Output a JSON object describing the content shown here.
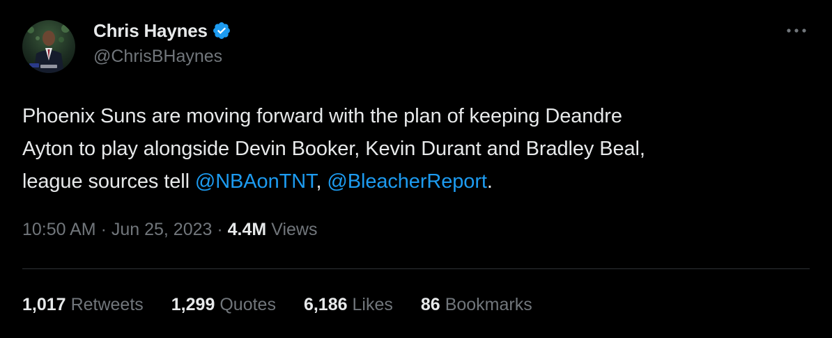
{
  "author": {
    "display_name": "Chris Haynes",
    "handle": "@ChrisBHaynes",
    "verified_icon": "verified-badge-icon"
  },
  "more_icon": "more-options-icon",
  "tweet": {
    "line1": "Phoenix Suns are moving forward with the plan of keeping Deandre",
    "line2": "Ayton to play alongside Devin Booker, Kevin Durant and Bradley Beal,",
    "line3_prefix": "league sources tell ",
    "mention1": "@NBAonTNT",
    "separator": ", ",
    "mention2": "@BleacherReport",
    "suffix": "."
  },
  "meta": {
    "time": "10:50 AM",
    "dot1": " · ",
    "date": "Jun 25, 2023",
    "dot2": " · ",
    "views_count": "4.4M",
    "views_label": "Views"
  },
  "stats": [
    {
      "count": "1,017",
      "label": "Retweets"
    },
    {
      "count": "1,299",
      "label": "Quotes"
    },
    {
      "count": "6,186",
      "label": "Likes"
    },
    {
      "count": "86",
      "label": "Bookmarks"
    }
  ],
  "colors": {
    "background": "#000000",
    "text": "#e7e9ea",
    "muted": "#71767b",
    "link": "#1d9bf0",
    "divider": "#2f3336"
  }
}
